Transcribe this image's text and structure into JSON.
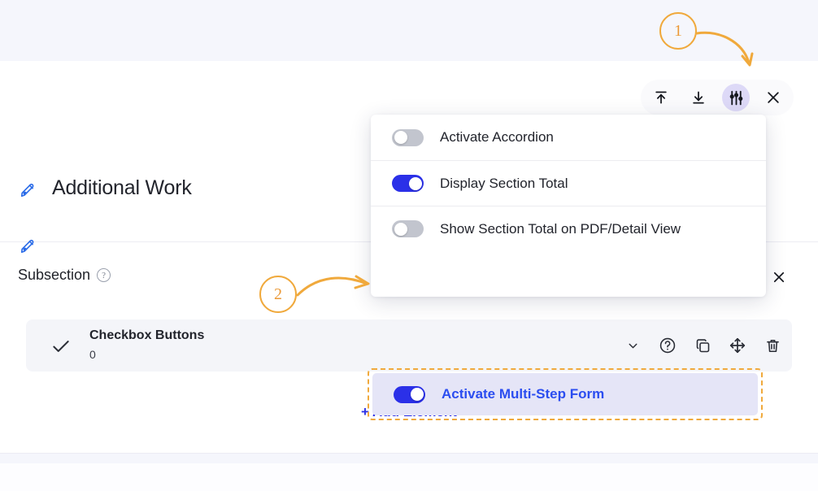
{
  "colors": {
    "page_bg": "#f5f6fc",
    "card_bg": "#ffffff",
    "accent_blue": "#2b30e8",
    "highlight_blue": "#2b4df0",
    "highlight_bg": "#e5e5f7",
    "annotation_orange": "#f0a93c",
    "row_bg": "#f4f5f9",
    "toggle_off": "#c2c5ce"
  },
  "section": {
    "title": "Additional Work",
    "title_icon": "pen-edit-icon",
    "subtitle_icon": "pen-edit-icon"
  },
  "toolbar": {
    "buttons": [
      {
        "name": "move-to-top-icon",
        "glyph": "move-up"
      },
      {
        "name": "move-to-bottom-icon",
        "glyph": "move-down"
      },
      {
        "name": "settings-sliders-icon",
        "glyph": "sliders",
        "active": true
      },
      {
        "name": "close-icon",
        "glyph": "x"
      }
    ]
  },
  "subsection": {
    "label": "Subsection",
    "help_icon": "?",
    "close_icon": "close-icon"
  },
  "element": {
    "check_icon": "checkmark-icon",
    "name": "Checkbox Buttons",
    "value": "0",
    "actions": [
      {
        "name": "chevron-down-icon"
      },
      {
        "name": "help-icon"
      },
      {
        "name": "duplicate-icon"
      },
      {
        "name": "move-icon"
      },
      {
        "name": "delete-icon"
      }
    ]
  },
  "add_element": {
    "label": "+ Add Element"
  },
  "settings_panel": {
    "options": [
      {
        "label": "Activate Accordion",
        "enabled": false,
        "highlighted": false
      },
      {
        "label": "Display Section Total",
        "enabled": true,
        "highlighted": false
      },
      {
        "label": "Show Section Total on PDF/Detail View",
        "enabled": false,
        "highlighted": false
      },
      {
        "label": "Activate Multi-Step Form",
        "enabled": true,
        "highlighted": true
      }
    ]
  },
  "annotations": [
    {
      "number": "1",
      "target": "settings-sliders-icon"
    },
    {
      "number": "2",
      "target": "activate-multi-step-form-option"
    }
  ]
}
